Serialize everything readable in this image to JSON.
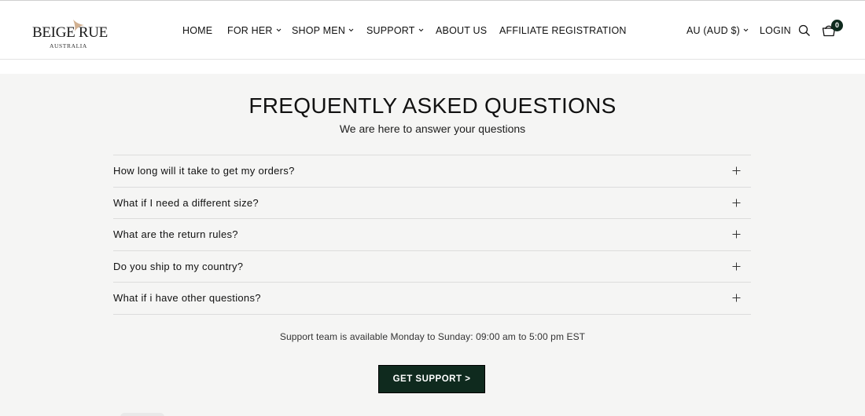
{
  "header": {
    "logo": {
      "name": "BEIGE RUE",
      "sub": "AUSTRALIA"
    },
    "nav": [
      {
        "label": "HOME",
        "has_dropdown": false
      },
      {
        "label": "FOR HER",
        "has_dropdown": true
      },
      {
        "label": "SHOP MEN",
        "has_dropdown": true
      },
      {
        "label": "SUPPORT",
        "has_dropdown": true
      },
      {
        "label": "ABOUT US",
        "has_dropdown": false
      },
      {
        "label": "AFFILIATE REGISTRATION",
        "has_dropdown": false
      }
    ],
    "currency": "AU (AUD $)",
    "login": "LOGIN",
    "cart_count": "0",
    "icons": [
      "search-icon",
      "cart-icon",
      "chevron-down-icon"
    ]
  },
  "faq": {
    "title": "FREQUENTLY ASKED QUESTIONS",
    "subtitle": "We are here to answer your questions",
    "items": [
      {
        "question": "How long will it take to get my orders?"
      },
      {
        "question": "What if I need a different size?"
      },
      {
        "question": "What are the return rules?"
      },
      {
        "question": "Do you ship to my country?"
      },
      {
        "question": "What if i have other questions?"
      }
    ],
    "support_text": "Support team is available Monday to Sunday: 09:00 am to 5:00 pm EST",
    "support_button": "GET SUPPORT >"
  },
  "colors": {
    "accent": "#0f2a1e",
    "background": "#f5f5f4",
    "logo_mark": "#c9a27e"
  }
}
